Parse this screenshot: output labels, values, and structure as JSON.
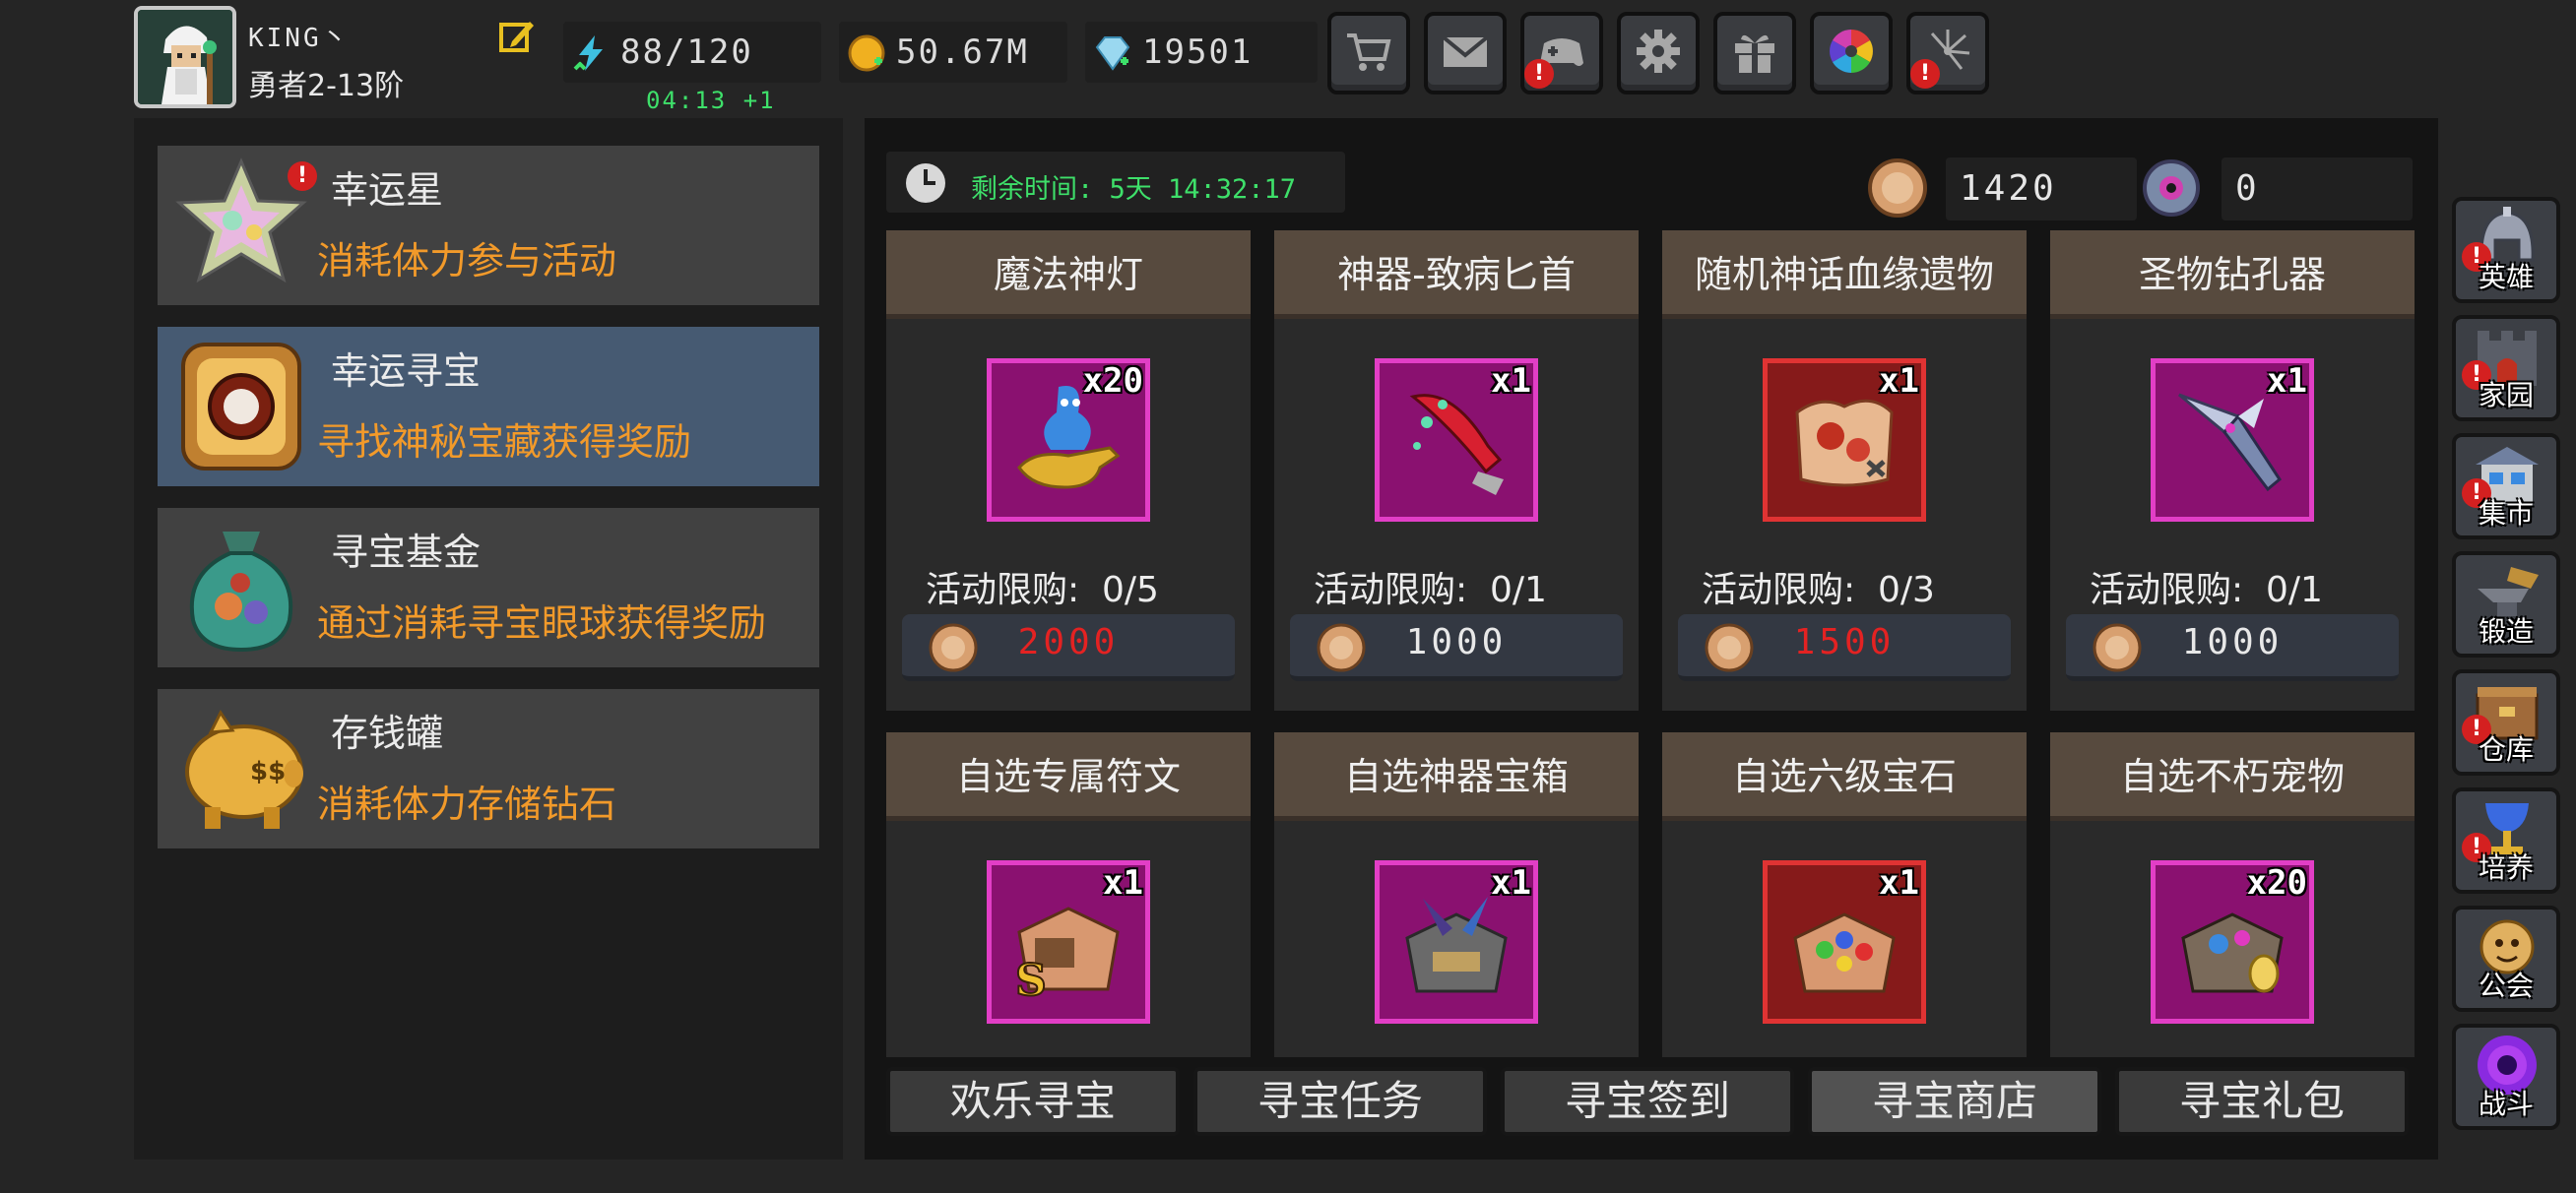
{
  "player": {
    "name": "KING丶",
    "rank": "勇者2-13阶",
    "avatar_icon": "wizard-avatar-icon"
  },
  "resources": {
    "stamina": {
      "value": "88/120",
      "icon": "lightning-icon",
      "regen": "04:13 +1"
    },
    "gold": {
      "value": "50.67M",
      "icon": "gold-coin-icon"
    },
    "diamond": {
      "value": "19501",
      "icon": "diamond-icon"
    }
  },
  "top_buttons": [
    {
      "name": "shop-cart",
      "icon": "cart-icon",
      "alert": false
    },
    {
      "name": "mail",
      "icon": "mail-icon",
      "alert": false
    },
    {
      "name": "gamepad",
      "icon": "gamepad-icon",
      "alert": true
    },
    {
      "name": "settings",
      "icon": "gear-icon",
      "alert": false
    },
    {
      "name": "gift",
      "icon": "gift-icon",
      "alert": false
    },
    {
      "name": "color-wheel",
      "icon": "color-wheel-icon",
      "alert": false
    },
    {
      "name": "fireworks",
      "icon": "fireworks-icon",
      "alert": true
    }
  ],
  "events": [
    {
      "title": "幸运星",
      "desc": "消耗体力参与活动",
      "icon": "lucky-star-icon",
      "alert": true,
      "selected": false
    },
    {
      "title": "幸运寻宝",
      "desc": "寻找神秘宝藏获得奖励",
      "icon": "treasure-compass-icon",
      "alert": false,
      "selected": true
    },
    {
      "title": "寻宝基金",
      "desc": "通过消耗寻宝眼球获得奖励",
      "icon": "money-bag-icon",
      "alert": false,
      "selected": false
    },
    {
      "title": "存钱罐",
      "desc": "消耗体力存储钻石",
      "icon": "piggy-bank-icon",
      "alert": false,
      "selected": false
    }
  ],
  "timer": {
    "label": "剩余时间: 5天 14:32:17"
  },
  "currencies": [
    {
      "value": "1420",
      "icon": "treasure-coin-icon"
    },
    {
      "value": "0",
      "icon": "eye-orb-icon"
    }
  ],
  "shop_items": [
    {
      "name": "魔法神灯",
      "qty": "x20",
      "limit": "活动限购:  0/5",
      "price": "2000",
      "price_insufficient": true,
      "rarity": "epic",
      "icon": "magic-lamp-icon"
    },
    {
      "name": "神器-致病匕首",
      "qty": "x1",
      "limit": "活动限购:  0/1",
      "price": "1000",
      "price_insufficient": false,
      "rarity": "epic",
      "icon": "dagger-icon"
    },
    {
      "name": "随机神话血缘遗物",
      "qty": "x1",
      "limit": "活动限购:  0/3",
      "price": "1500",
      "price_insufficient": true,
      "rarity": "legendary",
      "icon": "relic-icon"
    },
    {
      "name": "圣物钻孔器",
      "qty": "x1",
      "limit": "活动限购:  0/1",
      "price": "1000",
      "price_insufficient": false,
      "rarity": "epic",
      "icon": "drill-icon"
    },
    {
      "name": "自选专属符文",
      "qty": "x1",
      "limit": "",
      "price": "",
      "rarity": "epic",
      "icon": "rune-chest-icon"
    },
    {
      "name": "自选神器宝箱",
      "qty": "x1",
      "limit": "",
      "price": "",
      "rarity": "epic",
      "icon": "artifact-chest-icon"
    },
    {
      "name": "自选六级宝石",
      "qty": "x1",
      "limit": "",
      "price": "",
      "rarity": "legendary",
      "icon": "gem-chest-icon"
    },
    {
      "name": "自选不朽宠物",
      "qty": "x20",
      "limit": "",
      "price": "",
      "rarity": "epic",
      "icon": "pet-chest-icon"
    }
  ],
  "tabs": [
    {
      "label": "欢乐寻宝",
      "active": false
    },
    {
      "label": "寻宝任务",
      "active": false
    },
    {
      "label": "寻宝签到",
      "active": false
    },
    {
      "label": "寻宝商店",
      "active": true
    },
    {
      "label": "寻宝礼包",
      "active": false
    }
  ],
  "side_nav": [
    {
      "label": "英雄",
      "icon": "helmet-icon",
      "alert": true
    },
    {
      "label": "家园",
      "icon": "castle-icon",
      "alert": true
    },
    {
      "label": "集市",
      "icon": "market-icon",
      "alert": true
    },
    {
      "label": "锻造",
      "icon": "anvil-icon",
      "alert": false
    },
    {
      "label": "仓库",
      "icon": "warehouse-icon",
      "alert": true
    },
    {
      "label": "培养",
      "icon": "chalice-icon",
      "alert": true
    },
    {
      "label": "公会",
      "icon": "guild-icon",
      "alert": false
    },
    {
      "label": "战斗",
      "icon": "portal-icon",
      "alert": false
    }
  ],
  "colors": {
    "accent_orange": "#f29a2a",
    "timer_green": "#3ee06a",
    "price_red": "#e42222",
    "epic": "#e23ec6",
    "legendary": "#e03333",
    "selected_card": "#465a72"
  }
}
